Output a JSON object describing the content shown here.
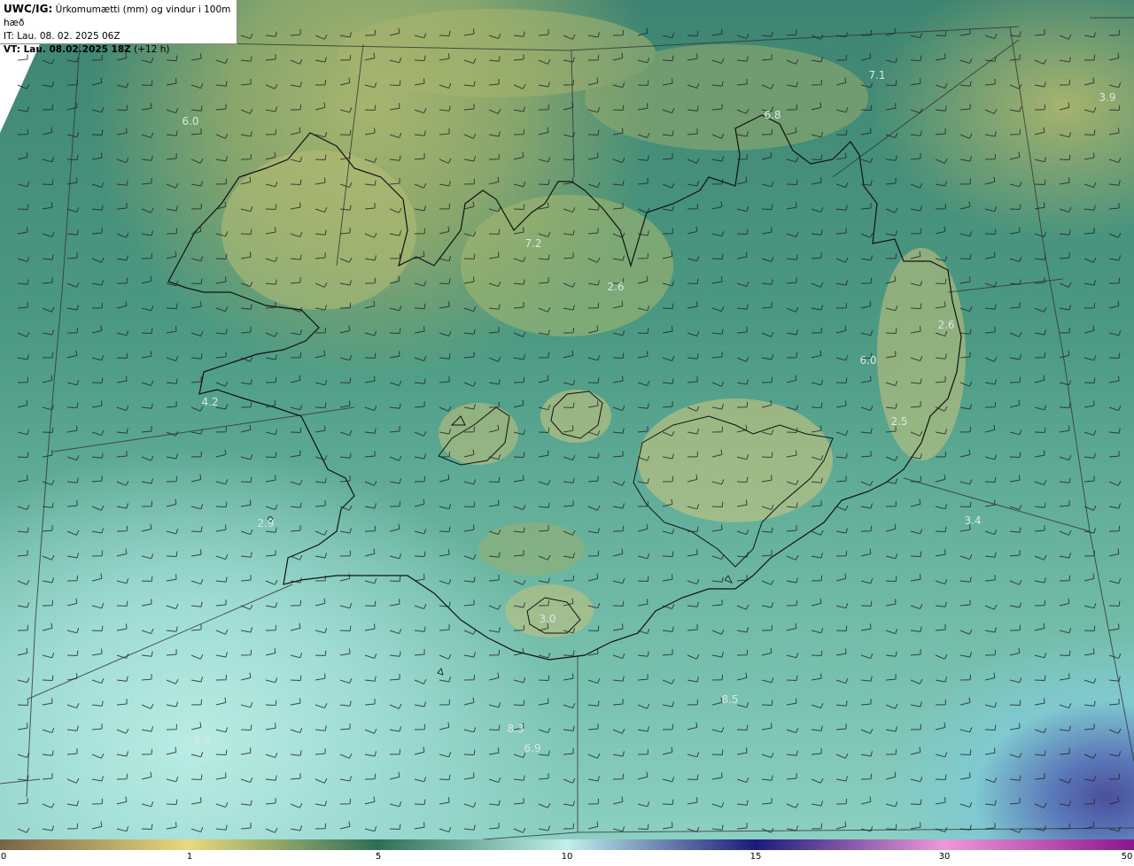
{
  "header": {
    "model": "UWC/IG:",
    "title": "Úrkomumætti (mm) og vindur i 100m hæð",
    "init_time": "IT: Lau. 08. 02. 2025 06Z",
    "valid_time_prefix": "VT: ",
    "valid_time": "Lau. 08.02.2025 18Z",
    "valid_offset": " (+12 h)"
  },
  "value_labels": [
    "6.0",
    "7.1",
    "6.8",
    "3.9",
    "7.2",
    "2.6",
    "2.6",
    "6.0",
    "4.2",
    "2.5",
    "3.4",
    "3.0",
    "8.5",
    "8.3",
    "6.9",
    "9.6",
    "2.9"
  ],
  "colorbar": {
    "ticks": [
      "0",
      "1",
      "5",
      "10",
      "15",
      "30",
      "50"
    ],
    "colors": [
      "#7a6248",
      "#e9d97d",
      "#2f6e55",
      "#bff0ea",
      "#1b1b7a",
      "#ef98d8",
      "#8a168e"
    ]
  }
}
